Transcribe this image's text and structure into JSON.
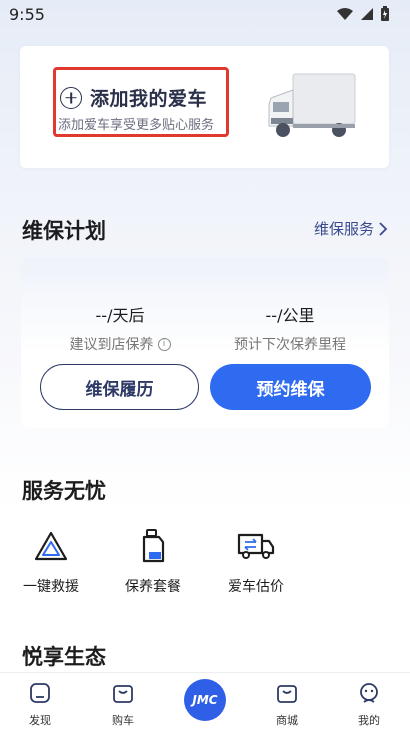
{
  "status_bar": {
    "time": "9:55"
  },
  "car_card": {
    "title": "添加我的爱车",
    "subtitle": "添加爱车享受更多贴心服务"
  },
  "maintenance": {
    "title": "维保计划",
    "link": "维保服务",
    "days_value": "--/天后",
    "days_label": "建议到店保养",
    "km_value": "--/公里",
    "km_label": "预计下次保养里程",
    "history_button": "维保履历",
    "book_button": "预约维保"
  },
  "services": {
    "title": "服务无忧",
    "items": [
      {
        "label": "一键救援",
        "icon": "warning-triangle-icon"
      },
      {
        "label": "保养套餐",
        "icon": "oil-bottle-icon"
      },
      {
        "label": "爱车估价",
        "icon": "truck-exchange-icon"
      }
    ]
  },
  "ecosystem": {
    "title": "悦享生态"
  },
  "tabbar": {
    "items": [
      {
        "label": "发现",
        "icon": "discover-icon"
      },
      {
        "label": "购车",
        "icon": "shopping-bag-icon"
      },
      {
        "label": "JMC",
        "icon": "jmc-logo"
      },
      {
        "label": "商城",
        "icon": "mall-icon"
      },
      {
        "label": "我的",
        "icon": "profile-icon"
      }
    ]
  },
  "colors": {
    "accent": "#2f6bf0",
    "highlight_border": "#e03a2f",
    "navy": "#2e3a66"
  }
}
